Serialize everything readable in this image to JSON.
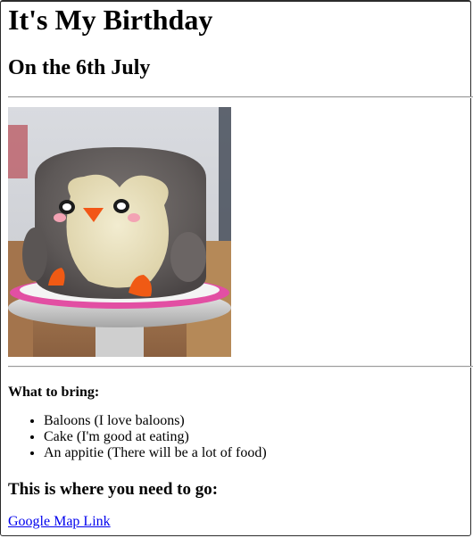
{
  "page": {
    "title": "It's My Birthday",
    "subtitle": "On the 6th July"
  },
  "image": {
    "icon": "penguin-cake"
  },
  "bring": {
    "heading": "What to bring:",
    "items": [
      "Baloons (I love baloons)",
      "Cake (I'm good at eating)",
      "An appitie (There will be a lot of food)"
    ]
  },
  "location": {
    "heading": "This is where you need to go:",
    "link_text": "Google Map Link"
  },
  "colors": {
    "link": "#0000ee",
    "rule": "#9a9a9a"
  }
}
